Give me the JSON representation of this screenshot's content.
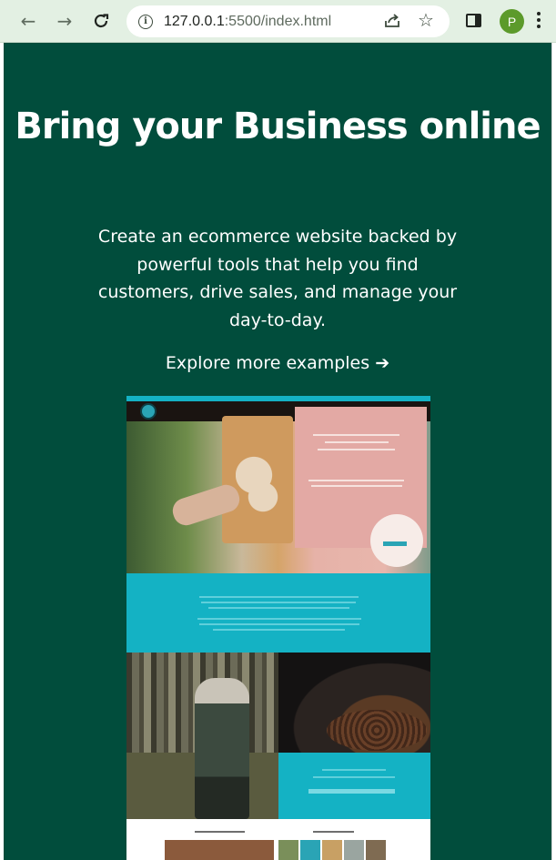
{
  "browser": {
    "url_host": "127.0.0.1",
    "url_rest": ":5500/index.html",
    "profile_initial": "P",
    "colors": {
      "chrome": "#e3f0e3",
      "avatar": "#5c9a2b"
    }
  },
  "hero": {
    "title": "Bring your Business online",
    "subtitle": "Create an ecommerce website backed by powerful tools that help you find customers, drive sales, and manage your day-to-day.",
    "link_label": "Explore more examples",
    "link_arrow": "➔"
  },
  "colors": {
    "background": "#014d3c",
    "text": "#ffffff",
    "preview_teal": "#14b2c4"
  },
  "preview": {
    "description_icon": "example-store-screenshot"
  }
}
